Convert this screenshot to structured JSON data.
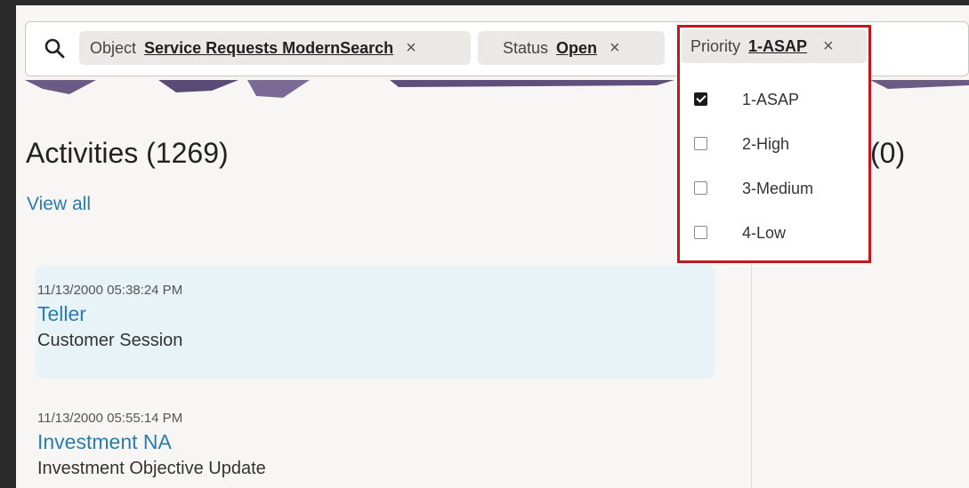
{
  "search": {
    "chips": [
      {
        "label": "Object",
        "value": "Service Requests ModernSearch",
        "remove": "×"
      },
      {
        "label": "Status",
        "value": "Open",
        "remove": "×"
      }
    ],
    "priority_chip": {
      "label": "Priority",
      "value": "1-ASAP",
      "remove": "×"
    },
    "priority_options": [
      {
        "label": "1-ASAP",
        "checked": true
      },
      {
        "label": "2-High",
        "checked": false
      },
      {
        "label": "3-Medium",
        "checked": false
      },
      {
        "label": "4-Low",
        "checked": false
      }
    ]
  },
  "main": {
    "activities_title": "Activities (1269)",
    "second_title_partial": "(0)",
    "view_all": "View all",
    "activities": [
      {
        "timestamp": "11/13/2000 05:38:24 PM",
        "title": "Teller",
        "subtitle": "Customer Session"
      },
      {
        "timestamp": "11/13/2000 05:55:14 PM",
        "title": "Investment NA",
        "subtitle": "Investment Objective Update"
      }
    ]
  },
  "colors": {
    "link": "#2a7cae",
    "highlight_border": "#c4161c",
    "card_highlight": "#e8f3f7"
  }
}
